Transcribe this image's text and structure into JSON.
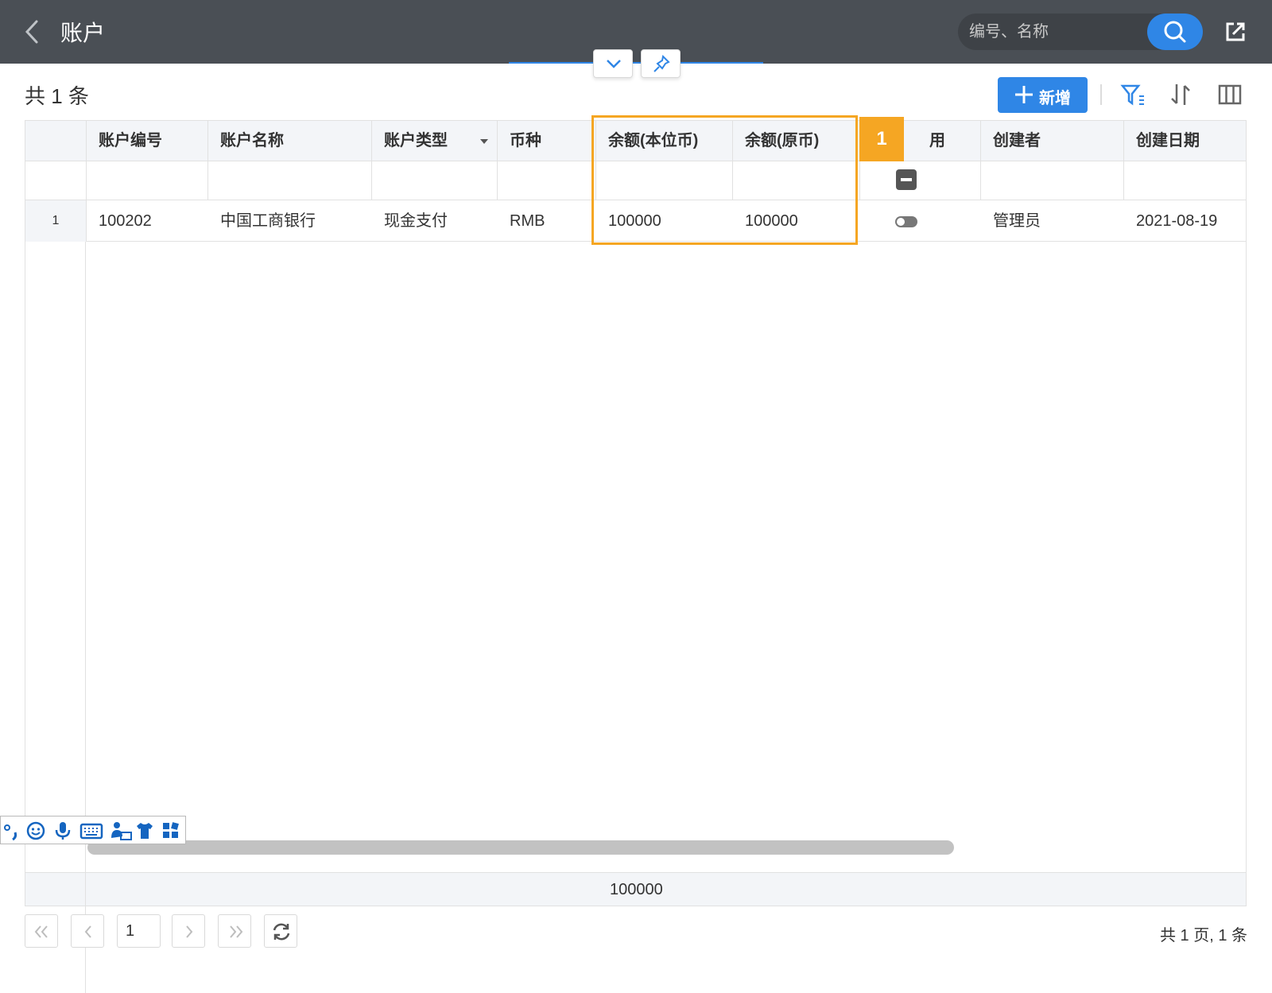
{
  "header": {
    "title": "账户",
    "search_placeholder": "编号、名称"
  },
  "toolbar": {
    "count": "共 1 条",
    "add_label": "新增"
  },
  "table": {
    "columns": [
      "账户编号",
      "账户名称",
      "账户类型",
      "币种",
      "余额(本位币)",
      "余额(原币)",
      "停用",
      "创建者",
      "创建日期"
    ],
    "visible_header_texts": [
      "账户编号",
      "账户名称",
      "账户类型",
      "币种",
      "余额(本位币)",
      "余额(原币)",
      "用",
      "创建者",
      "创建日期"
    ],
    "rows": [
      {
        "row_number": "1",
        "account_code": "100202",
        "account_name": "中国工商银行",
        "account_type": "现金支付",
        "currency": "RMB",
        "balance_base": "100000",
        "balance_original": "100000",
        "disabled": false,
        "creator": "管理员",
        "created_date": "2021-08-19"
      }
    ],
    "footer_sum": "100000"
  },
  "highlight": {
    "badge": "1"
  },
  "pagination": {
    "current_page": "1",
    "summary": "共 1 页, 1 条"
  },
  "colors": {
    "header_bg": "#4a4f55",
    "accent": "#2f86e6",
    "highlight": "#f5a623"
  }
}
